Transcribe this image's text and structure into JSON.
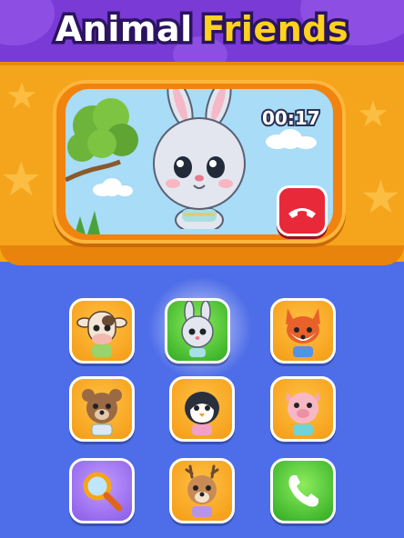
{
  "header": {
    "title_part1": "Animal",
    "title_part2": "Friends"
  },
  "call_screen": {
    "caller": "bunny",
    "timer": "00:17",
    "end_call_icon": "phone-hangup-icon"
  },
  "grid": [
    {
      "name": "cow",
      "icon": "cow-icon",
      "color": "orange"
    },
    {
      "name": "bunny",
      "icon": "bunny-icon",
      "color": "green",
      "selected": true
    },
    {
      "name": "fox",
      "icon": "fox-icon",
      "color": "orange"
    },
    {
      "name": "bear",
      "icon": "bear-icon",
      "color": "orange"
    },
    {
      "name": "penguin",
      "icon": "penguin-icon",
      "color": "orange"
    },
    {
      "name": "pig",
      "icon": "pig-icon",
      "color": "orange"
    },
    {
      "name": "search",
      "icon": "magnifier-icon",
      "color": "purple"
    },
    {
      "name": "deer",
      "icon": "deer-icon",
      "color": "orange"
    },
    {
      "name": "call",
      "icon": "phone-icon",
      "color": "green"
    }
  ],
  "colors": {
    "header": "#7a3ad6",
    "phone_body": "#f5a51c",
    "background": "#4e6de8",
    "end_call": "#e8293a"
  }
}
